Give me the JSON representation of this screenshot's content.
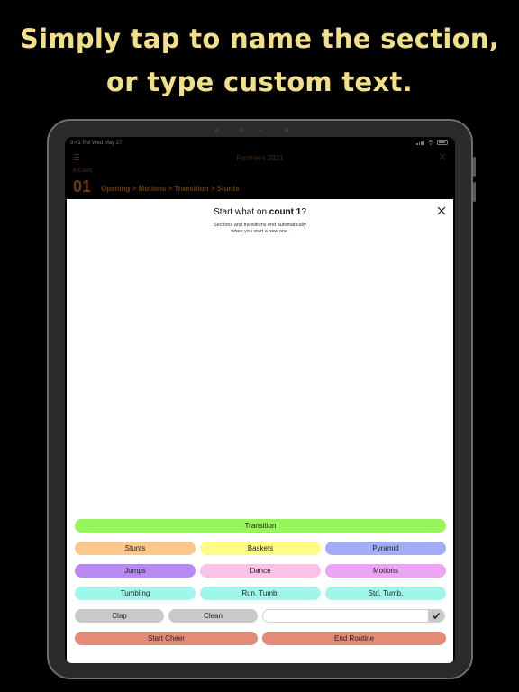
{
  "headline": {
    "line1": "Simply tap to name  the section,",
    "line2": "or type custom text."
  },
  "statusbar": {
    "time": "9:41 PM Wed May 27"
  },
  "topbar": {
    "title": "Panthers 2021"
  },
  "count_header": {
    "label": "8-Count",
    "number": "01",
    "breadcrumb": "Opening > Motions > Transition > Stunts"
  },
  "sheet": {
    "title_prefix": "Start what on ",
    "title_bold": "count 1",
    "title_suffix": "?",
    "subtitle_line1": "Sections and transitions end automatically",
    "subtitle_line2": "when you start a new one."
  },
  "buttons": {
    "transition": "Transition",
    "stunts": "Stunts",
    "baskets": "Baskets",
    "pyramid": "Pyramid",
    "jumps": "Jumps",
    "dance": "Dance",
    "motions": "Motions",
    "tumbling": "Tumbling",
    "run_tumb": "Run. Tumb.",
    "std_tumb": "Std. Tumb.",
    "clap": "Clap",
    "clean": "Clean",
    "start_cheer": "Start Cheer",
    "end_routine": "End Routine"
  },
  "custom_input": {
    "value": "",
    "placeholder": ""
  },
  "colors": {
    "headline": "#f2e089",
    "transition": "#97f65a",
    "stunts": "#fdc68a",
    "baskets": "#fdfd83",
    "pyramid": "#a3adf7",
    "jumps": "#b889f5",
    "dance": "#fcc1e6",
    "motions": "#eca2f5",
    "tumbling": "#9ff6ea",
    "clap_clean": "#c9c9c9",
    "start_end": "#e38b74"
  },
  "icons": {
    "close": "close-icon",
    "check": "checkmark-icon",
    "menu": "menu-icon",
    "wifi": "wifi-icon",
    "battery": "battery-icon"
  }
}
